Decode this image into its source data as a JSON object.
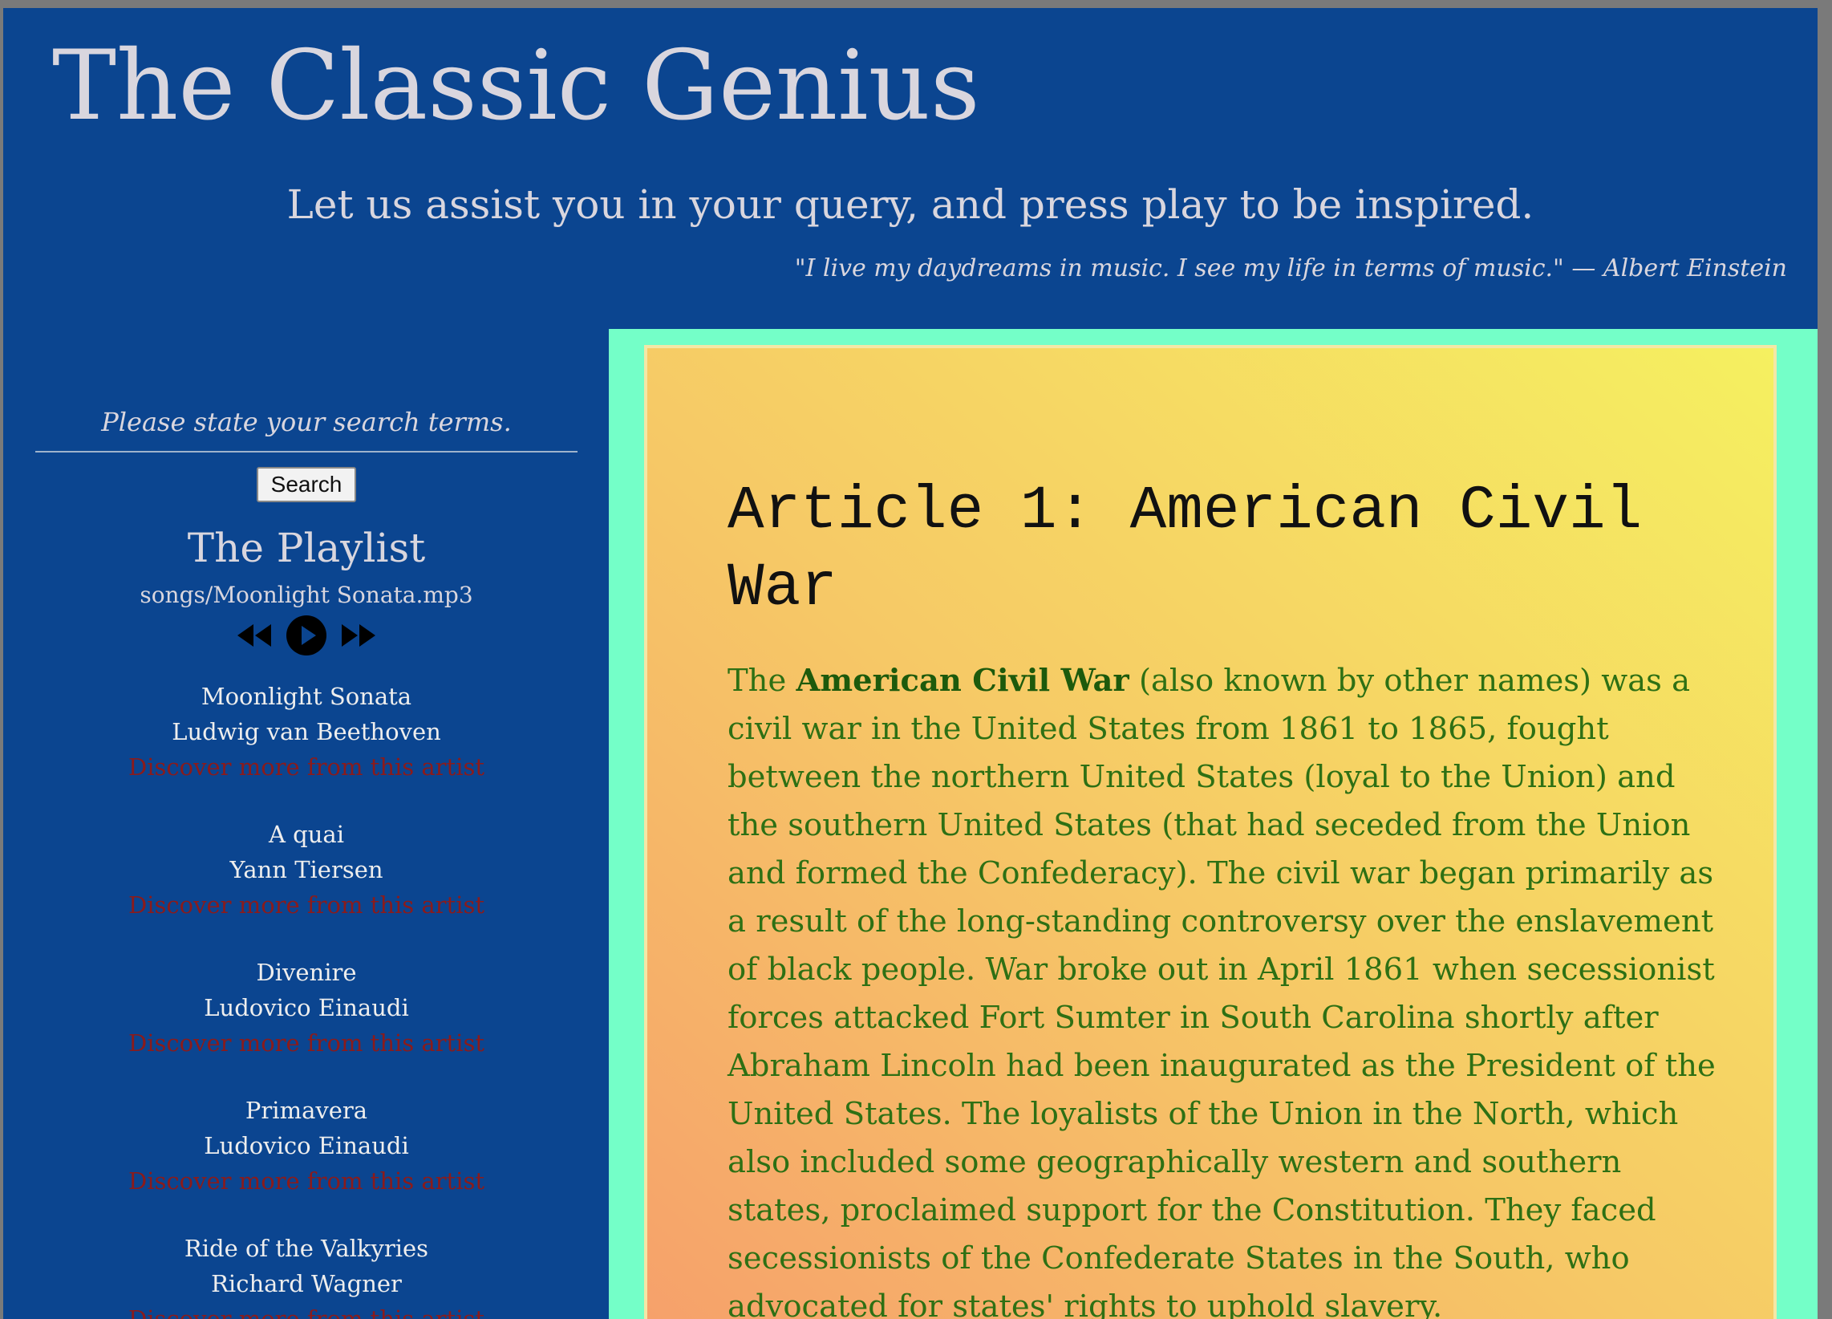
{
  "site": {
    "title": "The Classic Genius",
    "tagline": "Let us assist you in your query, and press play to be inspired.",
    "quote": "\"I live my daydreams in music. I see my life in terms of music.\" — Albert Einstein"
  },
  "search": {
    "placeholder": "Please state your search terms.",
    "button_label": "Search"
  },
  "playlist": {
    "title": "The Playlist",
    "now_playing": "songs/Moonlight Sonata.mp3",
    "controls": [
      "rewind-icon",
      "play-icon",
      "fast-forward-icon"
    ],
    "songs": [
      {
        "title": "Moonlight Sonata",
        "artist": "Ludwig van Beethoven",
        "link": "Discover more from this artist"
      },
      {
        "title": "A quai",
        "artist": "Yann Tiersen",
        "link": "Discover more from this artist"
      },
      {
        "title": "Divenire",
        "artist": "Ludovico Einaudi",
        "link": "Discover more from this artist"
      },
      {
        "title": "Primavera",
        "artist": "Ludovico Einaudi",
        "link": "Discover more from this artist"
      },
      {
        "title": "Ride of the Valkyries",
        "artist": "Richard Wagner",
        "link": "Discover more from this artist"
      }
    ]
  },
  "article": {
    "title": "Article 1: American Civil War",
    "body_lead": "The ",
    "body_bold": "American Civil War",
    "body_rest": " (also known by other names) was a civil war in the United States from 1861 to 1865, fought between the northern United States (loyal to the Union) and the southern United States (that had seceded from the Union and formed the Confederacy). The civil war began primarily as a result of the long-standing controversy over the enslavement of black people. War broke out in April 1861 when secessionist forces attacked Fort Sumter in South Carolina shortly after Abraham Lincoln had been inaugurated as the President of the United States. The loyalists of the Union in the North, which also included some geographically western and southern states, proclaimed support for the Constitution. They faced secessionists of the Confederate States in the South, who advocated for states' rights to uphold slavery."
  },
  "colors": {
    "page_background": "#0b4590",
    "main_frame": "#74ffc8",
    "article_gradient_start": "#f6a06b",
    "article_gradient_end": "#f5f060",
    "article_text": "#2e7014",
    "artist_link": "#8b1b1b"
  }
}
